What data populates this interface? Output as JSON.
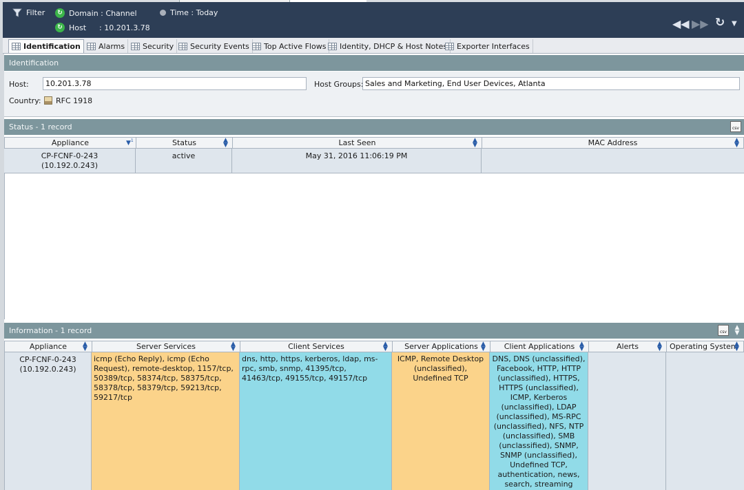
{
  "header": {
    "filter_label": "Filter",
    "domain_label": "Domain : Channel",
    "host_label": "Host",
    "host_value": ": 10.201.3.78",
    "time_label": "Time : Today"
  },
  "tabs": [
    {
      "label": "Identification",
      "active": true
    },
    {
      "label": "Alarms"
    },
    {
      "label": "Security"
    },
    {
      "label": "Security Events"
    },
    {
      "label": "Top Active Flows"
    },
    {
      "label": "Identity, DHCP & Host Notes"
    },
    {
      "label": "Exporter Interfaces"
    }
  ],
  "identification": {
    "section_title": "Identification",
    "host_label": "Host:",
    "host_value": "10.201.3.78",
    "host_groups_label": "Host Groups:",
    "host_groups_value": "Sales and Marketing, End User Devices, Atlanta",
    "country_label": "Country:",
    "country_value": "RFC 1918"
  },
  "status": {
    "section_title": "Status - 1 record",
    "columns": [
      "Appliance",
      "Status",
      "Last Seen",
      "MAC Address"
    ],
    "row": {
      "appliance": "CP-FCNF-0-243",
      "appliance_ip": "(10.192.0.243)",
      "status": "active",
      "last_seen": "May 31, 2016 11:06:19 PM",
      "mac": ""
    }
  },
  "information": {
    "section_title": "Information - 1 record",
    "columns": [
      "Appliance",
      "Server Services",
      "Client Services",
      "Server Applications",
      "Client Applications",
      "Alerts",
      "Operating System"
    ],
    "row": {
      "appliance": "CP-FCNF-0-243",
      "appliance_ip": "(10.192.0.243)",
      "server_services": "icmp (Echo Reply), icmp (Echo Request), remote-desktop, 1157/tcp, 50389/tcp, 58374/tcp, 58375/tcp, 58378/tcp, 58379/tcp, 59213/tcp, 59217/tcp",
      "client_services": "dns, http, https, kerberos, ldap, ms-rpc, smb, snmp, 41395/tcp, 41463/tcp, 49155/tcp, 49157/tcp",
      "server_applications": "ICMP, Remote Desktop (unclassified), Undefined TCP",
      "client_applications": "DNS, DNS (unclassified), Facebook, HTTP, HTTP (unclassified), HTTPS, HTTPS (unclassified), ICMP, Kerberos (unclassified), LDAP (unclassified), MS-RPC (unclassified), NFS, NTP (unclassified), SMB (unclassified), SNMP, SNMP (unclassified), Undefined TCP, authentication, news, search, streaming audio/video",
      "alerts": "",
      "operating_system": ""
    }
  },
  "colors": {
    "header_bg": "#2d3e56",
    "section_bar": "#7d969d",
    "server_highlight": "#fbd38a",
    "client_highlight": "#91dbe8"
  }
}
